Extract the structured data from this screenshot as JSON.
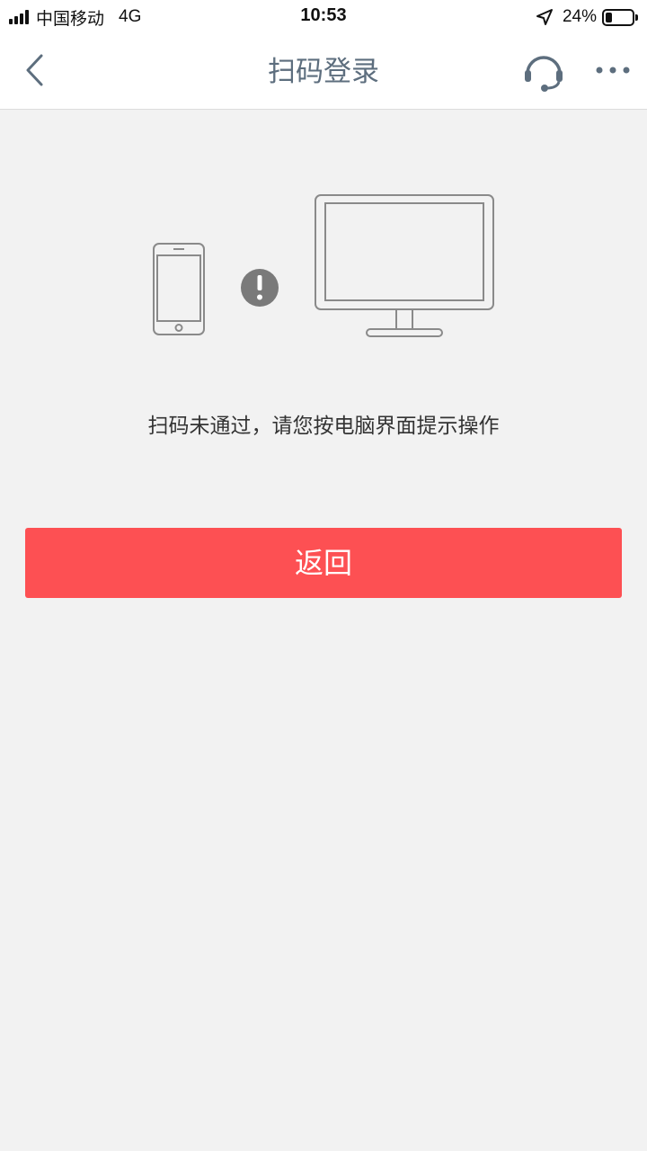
{
  "status_bar": {
    "carrier": "中国移动",
    "network": "4G",
    "time": "10:53",
    "battery_percent": "24%",
    "battery_level": 0.24,
    "icons": [
      "signal-icon",
      "location-arrow-icon",
      "battery-icon"
    ]
  },
  "nav": {
    "title": "扫码登录",
    "icons": [
      "back-chevron-icon",
      "headset-icon",
      "more-dots-icon"
    ]
  },
  "illustration": {
    "icons": [
      "phone-icon",
      "exclamation-icon",
      "monitor-icon"
    ]
  },
  "message": "扫码未通过，请您按电脑界面提示操作",
  "return_button": {
    "label": "返回"
  },
  "colors": {
    "background": "#f2f2f2",
    "title_gray": "#5d6e7e",
    "button_red": "#fd5053",
    "icon_gray": "#8a8a8a",
    "alert_gray": "#7a7a7a"
  }
}
